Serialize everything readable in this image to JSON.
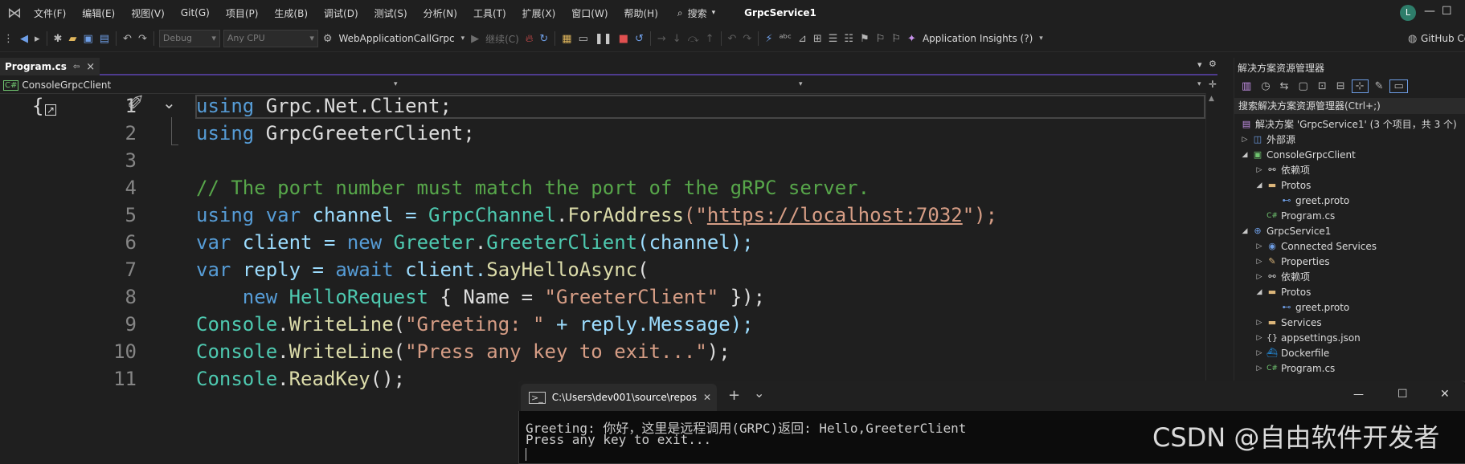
{
  "menu": {
    "items": [
      "文件(F)",
      "编辑(E)",
      "视图(V)",
      "Git(G)",
      "项目(P)",
      "生成(B)",
      "调试(D)",
      "测试(S)",
      "分析(N)",
      "工具(T)",
      "扩展(X)",
      "窗口(W)",
      "帮助(H)"
    ],
    "search_label": "搜索",
    "solution_title": "GrpcService1",
    "user_initial": "L",
    "min_glyph": "—",
    "max_glyph": "☐",
    "close_glyph": "✕"
  },
  "toolbar": {
    "config": "Debug",
    "platform": "Any CPU",
    "startup_project": "WebApplicationCallGrpc",
    "continue_label": "继续(C)",
    "app_insights": "Application Insights (?)",
    "github": "GitHub Co"
  },
  "editor": {
    "tab_label": "Program.cs",
    "tab_pin": "⇦",
    "tab_close": "×",
    "project_dropdown": "ConsoleGrpcClient",
    "line_numbers": [
      "1",
      "2",
      "3",
      "4",
      "5",
      "6",
      "7",
      "8",
      "9",
      "10",
      "11"
    ],
    "lines": {
      "l1": {
        "a": "using",
        "b": " Grpc.Net.Client;"
      },
      "l2": {
        "a": "using",
        "b": " GrpcGreeterClient;"
      },
      "l4": {
        "c": "// The port number must match the port of the gRPC server."
      },
      "l5": {
        "a": "using",
        "b": " ",
        "c": "var",
        "d": " channel = ",
        "e": "GrpcChannel",
        "f": ".",
        "g": "ForAddress",
        "h": "(\"",
        "i": "https://localhost:7032",
        "j": "\");"
      },
      "l6": {
        "a": "var",
        "b": " client = ",
        "c": "new",
        "d": " ",
        "e": "Greeter",
        "f": ".",
        "g": "GreeterClient",
        "h": "(channel);"
      },
      "l7": {
        "a": "var",
        "b": " reply = ",
        "c": "await",
        "d": " client.",
        "e": "SayHelloAsync",
        "f": "("
      },
      "l8": {
        "a": "    ",
        "b": "new",
        "c": " ",
        "d": "HelloRequest",
        "e": " { Name = ",
        "f": "\"GreeterClient\"",
        "g": " });"
      },
      "l9": {
        "a": "Console",
        "b": ".",
        "c": "WriteLine",
        "d": "(",
        "e": "\"Greeting: \"",
        "f": " + reply.Message);"
      },
      "l10": {
        "a": "Console",
        "b": ".",
        "c": "WriteLine",
        "d": "(",
        "e": "\"Press any key to exit...\"",
        "f": ");"
      },
      "l11": {
        "a": "Console",
        "b": ".",
        "c": "ReadKey",
        "d": "();"
      }
    }
  },
  "solution_explorer": {
    "title": "解决方案资源管理器",
    "search_placeholder": "搜索解决方案资源管理器(Ctrl+;)",
    "items": [
      {
        "label": "解决方案 'GrpcService1' (3 个项目，共 3 个)",
        "icon": "solution-icon"
      },
      {
        "label": "外部源",
        "icon": "external-sources-icon"
      },
      {
        "label": "ConsoleGrpcClient",
        "icon": "csharp-project-icon"
      },
      {
        "label": "依赖项",
        "icon": "dependencies-icon"
      },
      {
        "label": "Protos",
        "icon": "folder-icon"
      },
      {
        "label": "greet.proto",
        "icon": "proto-file-icon"
      },
      {
        "label": "Program.cs",
        "icon": "csharp-file-icon"
      },
      {
        "label": "GrpcService1",
        "icon": "web-project-icon"
      },
      {
        "label": "Connected Services",
        "icon": "connected-services-icon"
      },
      {
        "label": "Properties",
        "icon": "properties-icon"
      },
      {
        "label": "依赖项",
        "icon": "dependencies-icon"
      },
      {
        "label": "Protos",
        "icon": "folder-icon"
      },
      {
        "label": "greet.proto",
        "icon": "proto-file-icon"
      },
      {
        "label": "Services",
        "icon": "folder-icon"
      },
      {
        "label": "appsettings.json",
        "icon": "json-file-icon"
      },
      {
        "label": "Dockerfile",
        "icon": "docker-icon"
      },
      {
        "label": "Program.cs",
        "icon": "csharp-file-icon"
      }
    ]
  },
  "terminal": {
    "tab_title": "C:\\Users\\dev001\\source\\repos",
    "close_tab": "✕",
    "new_tab": "+",
    "dropdown": "⌄",
    "min": "—",
    "max": "☐",
    "close": "✕",
    "line1": "Greeting: 你好，这里是远程调用(GRPC)返回: Hello,GreeterClient",
    "line2": "Press any key to exit..."
  },
  "watermark": "CSDN @自由软件开发者",
  "colors": {
    "accent": "#4e3b8e",
    "keyword": "#569cd6",
    "type": "#4ec9b0",
    "method": "#dcdcaa",
    "string": "#d69d85",
    "comment": "#57a64a"
  }
}
